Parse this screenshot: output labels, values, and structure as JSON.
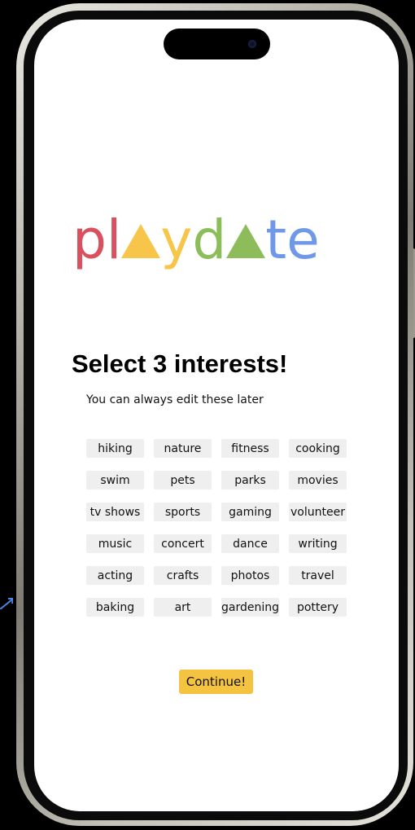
{
  "logo": {
    "letters": [
      "p",
      "l",
      "y",
      "d",
      "te"
    ],
    "colors": {
      "red": "#d9505e",
      "yellow": "#f6c54a",
      "green": "#8cbd5a",
      "blue": "#6f98e8"
    }
  },
  "heading": "Select 3 interests!",
  "subheading": "You can always edit these later",
  "interests": [
    "hiking",
    "nature",
    "fitness",
    "cooking",
    "swim",
    "pets",
    "parks",
    "movies",
    "tv shows",
    "sports",
    "gaming",
    "volunteer",
    "music",
    "concert",
    "dance",
    "writing",
    "acting",
    "crafts",
    "photos",
    "travel",
    "baking",
    "art",
    "gardening",
    "pottery"
  ],
  "continue_label": "Continue!",
  "accent_color": "#f5c342"
}
